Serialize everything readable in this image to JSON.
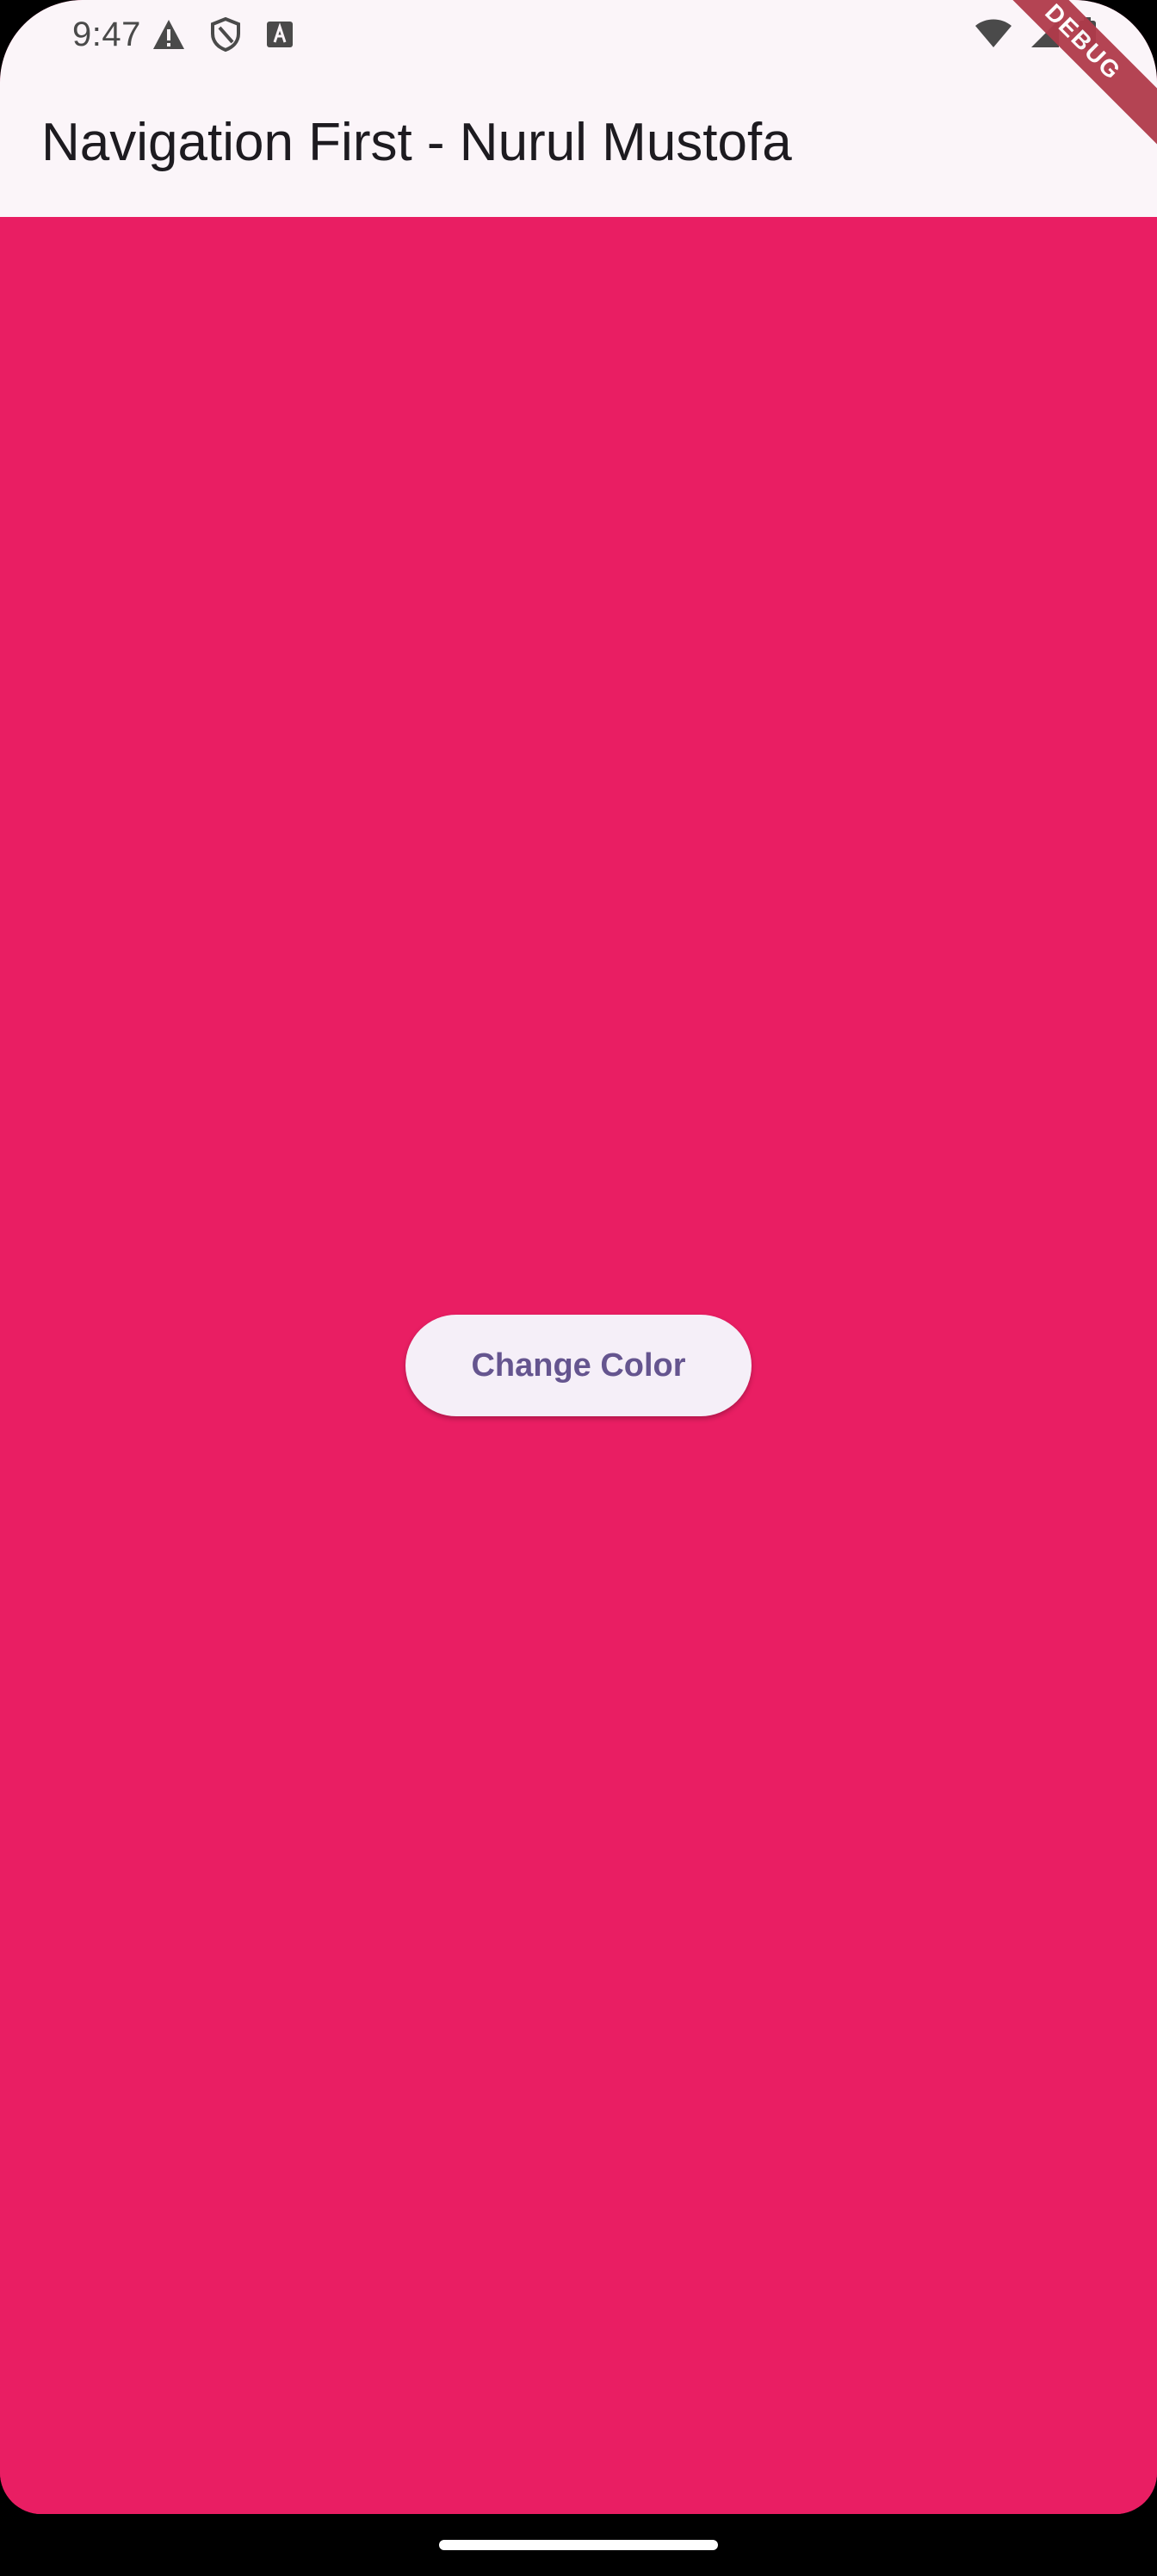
{
  "status_bar": {
    "time": "9:47",
    "left_icons": [
      "warning-icon",
      "shield-icon",
      "font-icon"
    ],
    "right_icons": [
      "wifi-icon",
      "signal-icon",
      "battery-icon"
    ]
  },
  "debug_banner": {
    "label": "DEBUG"
  },
  "app_bar": {
    "title": "Navigation First - Nurul Mustofa"
  },
  "main": {
    "background_color": "#e91e63",
    "button_label": "Change Color"
  },
  "colors": {
    "accent": "#e91e63",
    "app_bar_bg": "#fbf5f9",
    "button_bg": "#f5eff8",
    "button_text": "#65558f"
  }
}
